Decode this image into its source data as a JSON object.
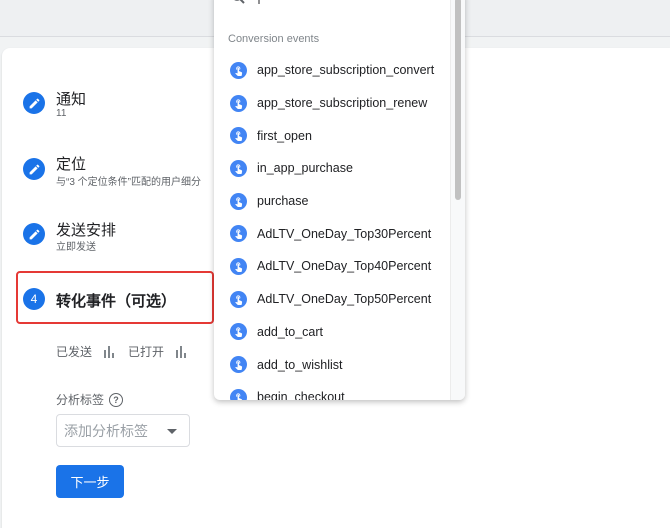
{
  "steps": [
    {
      "num": "",
      "title": "通知",
      "sub": "11",
      "state": "done"
    },
    {
      "num": "",
      "title": "定位",
      "sub": "与“3 个定位条件”匹配的用户细分",
      "state": "done"
    },
    {
      "num": "",
      "title": "发送安排",
      "sub": "立即发送",
      "state": "done"
    },
    {
      "num": "4",
      "title": "转化事件（可选）",
      "sub": "",
      "state": "active"
    }
  ],
  "stats": {
    "sent": "已发送",
    "opened": "已打开"
  },
  "analytics": {
    "label": "分析标签",
    "help_glyph": "?",
    "placeholder": "添加分析标签"
  },
  "next_button": "下一步",
  "dropdown": {
    "section_label": "Conversion events",
    "items": [
      "app_store_subscription_convert",
      "app_store_subscription_renew",
      "first_open",
      "in_app_purchase",
      "purchase",
      "AdLTV_OneDay_Top30Percent",
      "AdLTV_OneDay_Top40Percent",
      "AdLTV_OneDay_Top50Percent",
      "add_to_cart",
      "add_to_wishlist",
      "begin_checkout"
    ]
  },
  "colors": {
    "accent": "#1a73e8",
    "highlight": "#e53935",
    "event_icon": "#4285f4"
  },
  "icons": {
    "step_done": "pencil-icon",
    "event": "touch-icon",
    "search": "search-icon"
  }
}
